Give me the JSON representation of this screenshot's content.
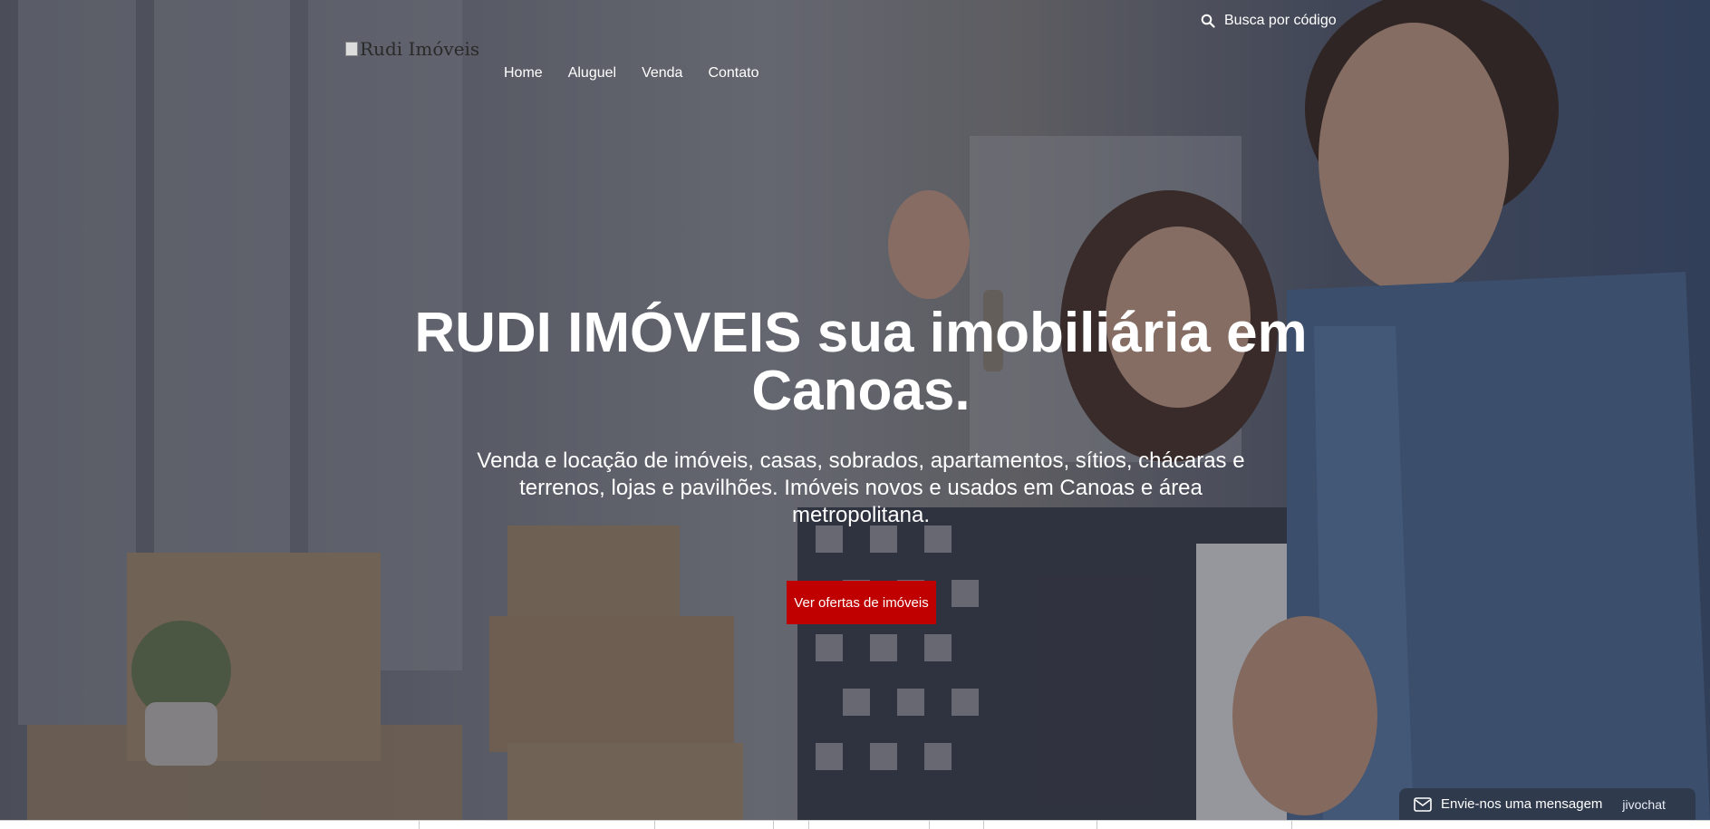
{
  "header": {
    "search_label": "Busca por código",
    "logo_alt": "Rudi Imóveis"
  },
  "nav": {
    "items": [
      "Home",
      "Aluguel",
      "Venda",
      "Contato"
    ]
  },
  "hero": {
    "headline": "RUDI IMÓVEIS sua imobiliária em Canoas.",
    "subtitle": "Venda e locação de imóveis, casas, sobrados, apartamentos, sítios, chácaras e terrenos, lojas e pavilhões. Imóveis novos e usados em Canoas e área metropolitana.",
    "cta_label": "Ver ofertas de imóveis"
  },
  "chat": {
    "label": "Envie-nos uma mensagem",
    "brand": "jivochat"
  },
  "colors": {
    "cta": "#c00000",
    "chat_bar": "#2f3a4c"
  },
  "icons": {
    "search": "search-icon",
    "envelope": "envelope-icon"
  }
}
